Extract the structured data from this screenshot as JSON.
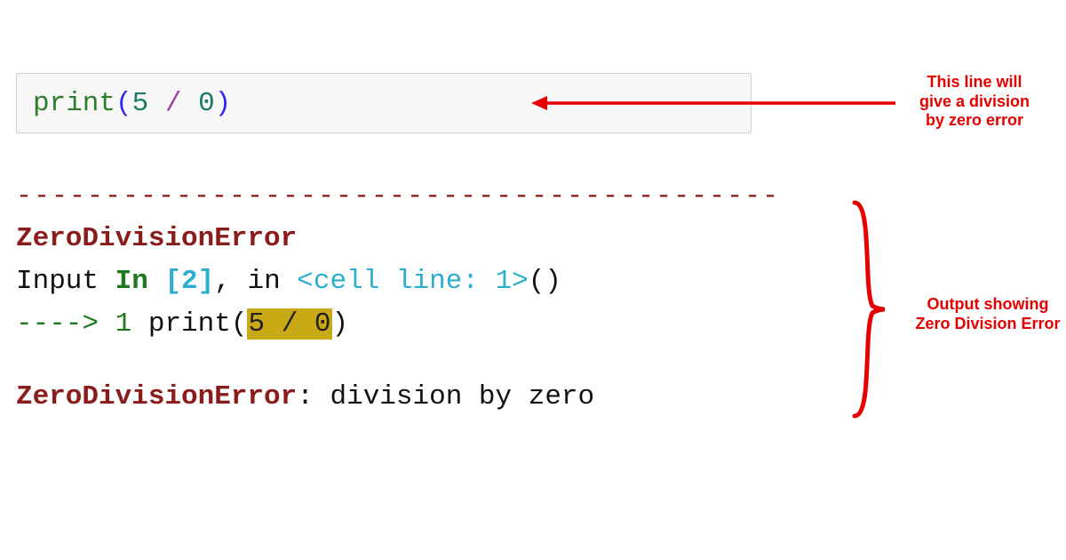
{
  "code": {
    "fn": "print",
    "lp": "(",
    "n1": "5",
    "sp1": " ",
    "op": "/",
    "sp2": " ",
    "n2": "0",
    "rp": ")"
  },
  "output": {
    "dashes": "---------------------------------------------",
    "error_name": "ZeroDivisionError",
    "trace_input": "Input ",
    "trace_in_kw": "In ",
    "trace_brk_open": "[",
    "trace_num": "2",
    "trace_brk_close": "]",
    "trace_comma": ", in ",
    "trace_cell": "<cell line: 1>",
    "trace_paren": "()",
    "arrow": "----> ",
    "lineno": "1",
    "sp": " ",
    "call_fn": "print",
    "call_lp": "(",
    "hl1": "5",
    "hl_sp1": " ",
    "hl_op": "/",
    "hl_sp2": " ",
    "hl2": "0",
    "call_rp": ")",
    "final_err": "ZeroDivisionError",
    "colon": ": ",
    "final_msg": "division by zero"
  },
  "annotations": {
    "a1_l1": "This line will",
    "a1_l2": "give a division",
    "a1_l3": "by zero error",
    "a2_l1": "Output showing",
    "a2_l2": "Zero Division Error"
  },
  "colors": {
    "annotation": "#e60000",
    "error": "#8b1c1c"
  }
}
